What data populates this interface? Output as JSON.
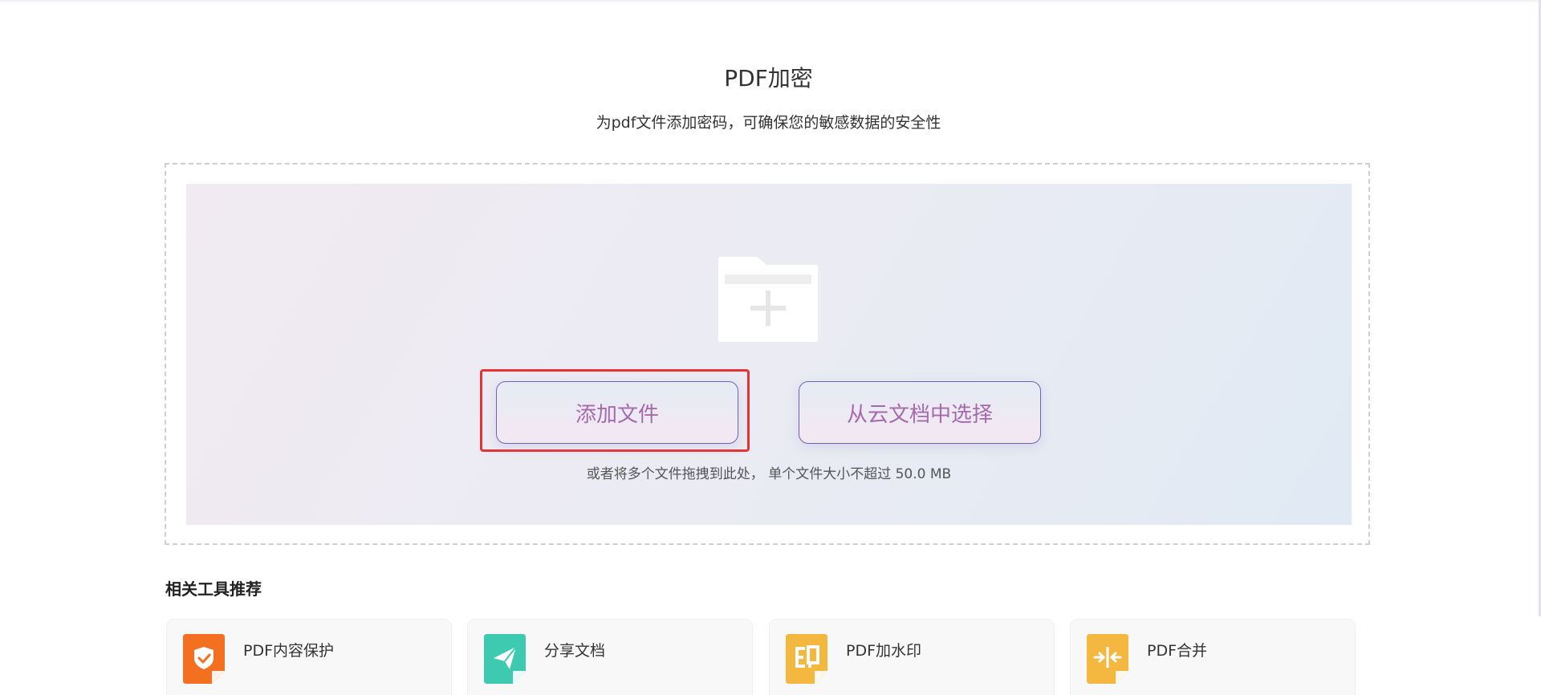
{
  "page": {
    "title": "PDF加密",
    "subtitle": "为pdf文件添加密码，可确保您的敏感数据的安全性"
  },
  "upload": {
    "add_file_label": "添加文件",
    "cloud_label": "从云文档中选择",
    "hint": "或者将多个文件拖拽到此处， 单个文件大小不超过 50.0 MB"
  },
  "related": {
    "title": "相关工具推荐",
    "tools": [
      {
        "label": "PDF内容保护",
        "icon": "shield-check-icon",
        "color": "#f2701f"
      },
      {
        "label": "分享文档",
        "icon": "paper-plane-icon",
        "color": "#3dcab0"
      },
      {
        "label": "PDF加水印",
        "icon": "stamp-icon",
        "color": "#f4b740"
      },
      {
        "label": "PDF合并",
        "icon": "merge-icon",
        "color": "#f4b740"
      }
    ]
  }
}
